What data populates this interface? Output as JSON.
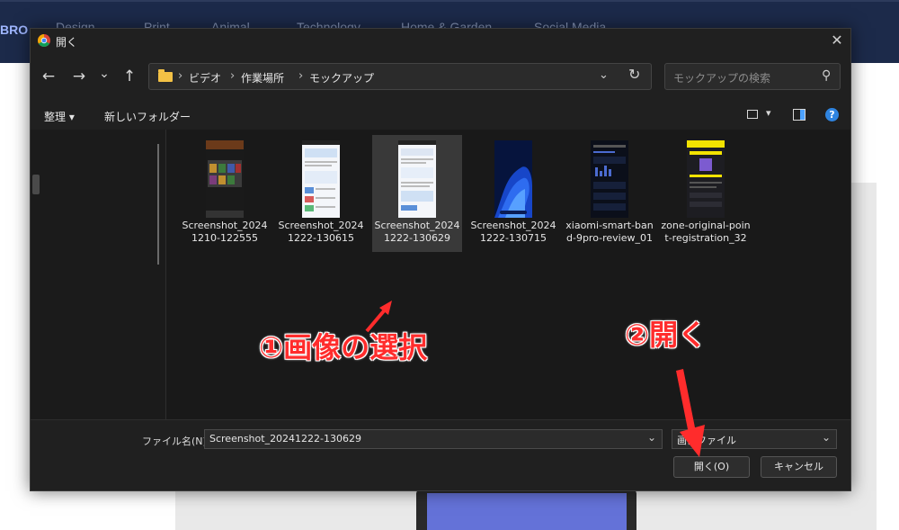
{
  "site": {
    "logo": "BRO",
    "nav_items": [
      "Design",
      "Print",
      "Animal",
      "Technology",
      "Home & Garden",
      "Social Media"
    ]
  },
  "dialog": {
    "title": "開く",
    "nav": {
      "back": "←",
      "forward": "→",
      "recent": "⌄",
      "up": "↑"
    },
    "breadcrumb": [
      "ビデオ",
      "作業場所",
      "モックアップ"
    ],
    "search_placeholder": "モックアップの検索",
    "toolbar": {
      "organize": "整理 ▾",
      "new_folder": "新しいフォルダー",
      "help": "?"
    },
    "files": [
      {
        "name": "Screenshot_20241210-122555",
        "selected": false
      },
      {
        "name": "Screenshot_20241222-130615",
        "selected": false
      },
      {
        "name": "Screenshot_20241222-130629",
        "selected": true
      },
      {
        "name": "Screenshot_20241222-130715",
        "selected": false
      },
      {
        "name": "xiaomi-smart-band-9pro-review_01",
        "selected": false
      },
      {
        "name": "zone-original-point-registration_32",
        "selected": false
      }
    ],
    "filename_label": "ファイル名(N):",
    "filename_value": "Screenshot_20241222-130629",
    "filetype_value": "画像ファイル",
    "open_button": "開く(O)",
    "cancel_button": "キャンセル"
  },
  "annotations": {
    "step1": "①画像の選択",
    "step2": "②開く"
  },
  "colors": {
    "annotation": "#ff2c2c",
    "accent": "#2f84e0",
    "folder": "#f3c145"
  }
}
